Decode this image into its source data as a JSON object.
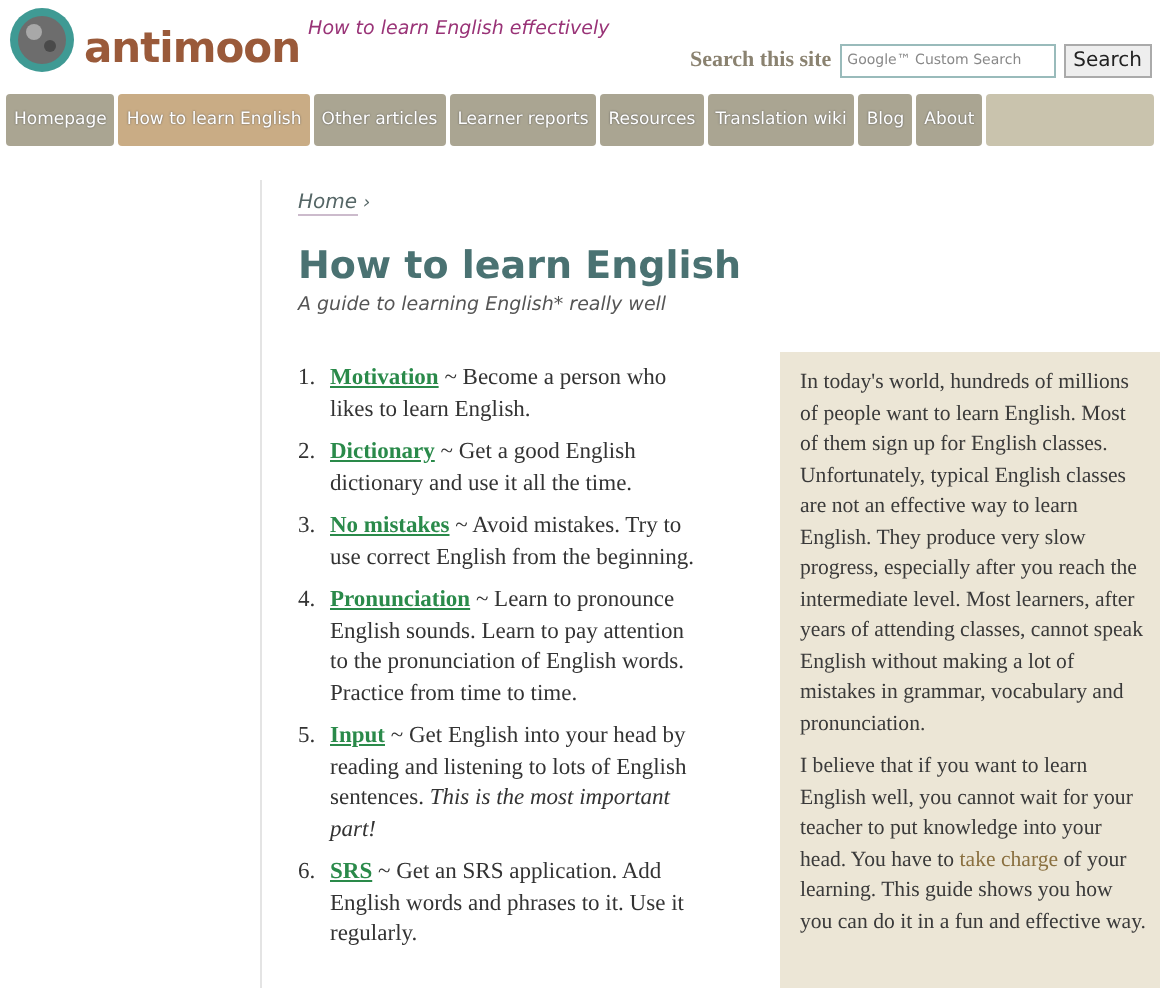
{
  "header": {
    "logo_text": "antimoon",
    "tagline": "How to learn English effectively",
    "search_label": "Search this site",
    "search": {
      "placeholder": "Google™ Custom Search"
    },
    "search_button": "Search"
  },
  "nav": [
    {
      "label": "Homepage",
      "selected": false
    },
    {
      "label": "How to learn English",
      "selected": true
    },
    {
      "label": "Other articles",
      "selected": false
    },
    {
      "label": "Learner reports",
      "selected": false
    },
    {
      "label": "Resources",
      "selected": false
    },
    {
      "label": "Translation wiki",
      "selected": false
    },
    {
      "label": "Blog",
      "selected": false
    },
    {
      "label": "About",
      "selected": false
    }
  ],
  "breadcrumb": {
    "link": "Home",
    "separator": "›"
  },
  "title": "How to learn English",
  "subtitle": "A guide to learning English* really well",
  "steps": [
    {
      "number": "1.",
      "link": "Motivation",
      "text": "~ Become a person who likes to learn English."
    },
    {
      "number": "2.",
      "link": "Dictionary",
      "text": "~ Get a good English dictionary and use it all the time."
    },
    {
      "number": "3.",
      "link": "No mistakes",
      "text": "~ Avoid mistakes. Try to use correct English from the beginning."
    },
    {
      "number": "4.",
      "link": "Pronunciation",
      "text": "~ Learn to pronounce English sounds. Learn to pay attention to the pronunciation of English words. Practice from time to time."
    },
    {
      "number": "5.",
      "link": "Input",
      "text": "~ Get English into your head by reading and listening to lots of English sentences. *This is the most important part!*"
    },
    {
      "number": "6.",
      "link": "SRS",
      "text": "~ Get an SRS application. Add English words and phrases to it. Use it regularly."
    }
  ],
  "sidebar": {
    "paragraphs": [
      {
        "before": "In today's world, hundreds of millions of people want to learn English. Most of them sign up for English classes. Unfortunately, typical English classes are not an effective way to learn English. They produce very slow progress, especially after you reach the intermediate level. Most learners, after years of attending classes, cannot speak English without making a lot of mistakes in grammar, vocabulary and pronunciation."
      },
      {
        "before": "I believe that if you want to learn English well, you cannot wait for your teacher to put knowledge into your head. You have to",
        "link": "take charge",
        "after": "of your learning. This guide shows you how you can do it in a fun and effective way."
      }
    ]
  }
}
